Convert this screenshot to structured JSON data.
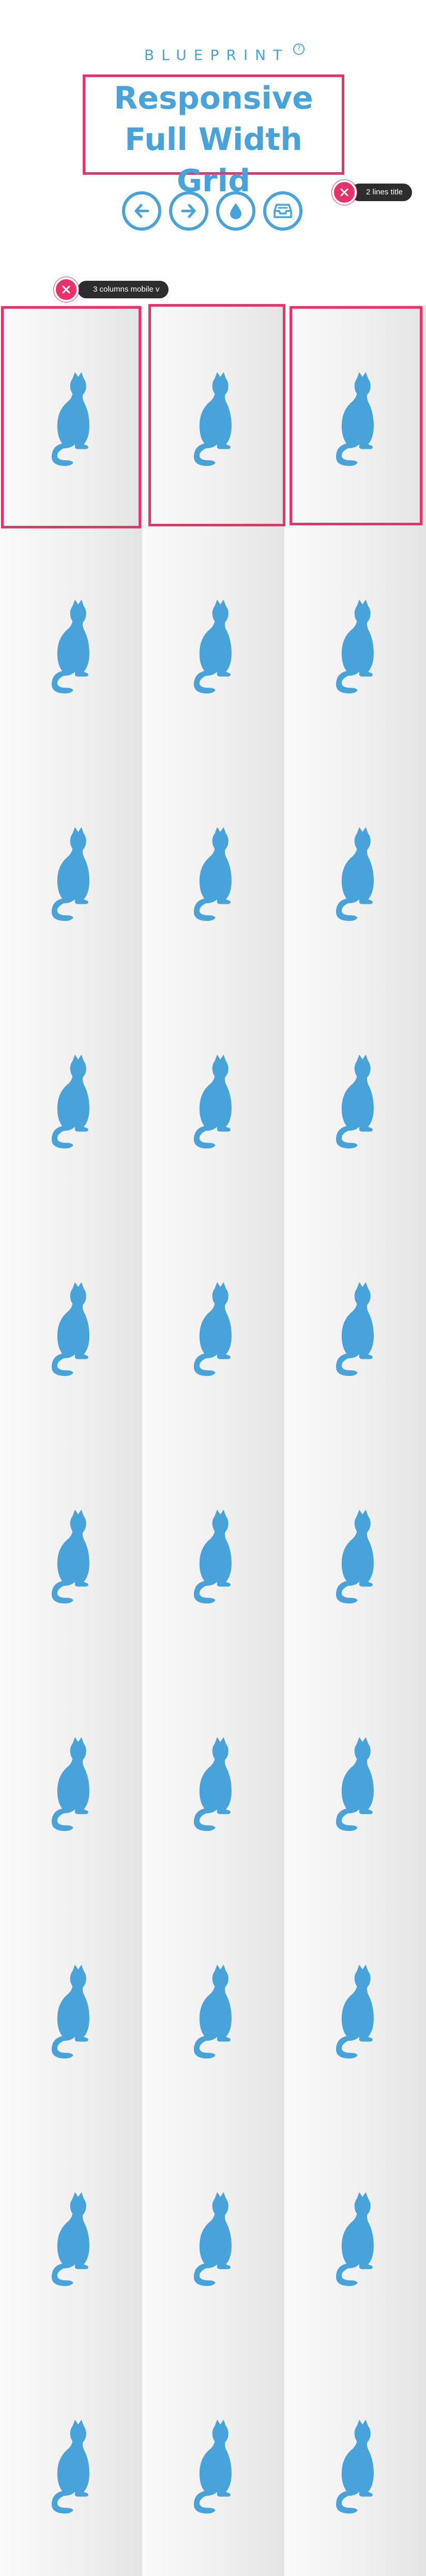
{
  "header": {
    "brand": "BLUEPRINT",
    "brand_mark": "?",
    "title": "Responsive Full Width Grid"
  },
  "nav_buttons": [
    {
      "icon": "arrow-left-icon"
    },
    {
      "icon": "arrow-right-icon"
    },
    {
      "icon": "drop-icon"
    },
    {
      "icon": "inbox-icon"
    }
  ],
  "annotations": {
    "title_note": "2 lines title",
    "grid_note": "3 columns mobile v"
  },
  "grid": {
    "columns": 3,
    "rows": 10,
    "item_icon": "cat-icon"
  },
  "colors": {
    "accent": "#47a3da",
    "highlight": "#e8336a",
    "tooltip": "#2d2d2d"
  }
}
